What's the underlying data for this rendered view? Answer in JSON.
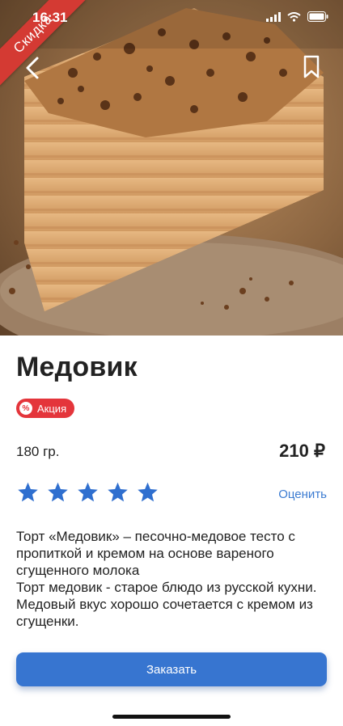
{
  "status_bar": {
    "time": "16:31"
  },
  "hero": {
    "ribbon_label": "Скидка"
  },
  "product": {
    "title": "Медовик",
    "badge": {
      "icon": "%",
      "label": "Акция"
    },
    "weight": "180 гр.",
    "price": "210 ₽",
    "rating": {
      "stars": 5,
      "rate_label": "Оценить"
    },
    "description": [
      "Торт «Медовик» – песочно-медовое тесто с пропиткой и кремом на основе вареного сгущенного молока",
      "Торт медовик - старое блюдо из русской кухни. Медовый вкус хорошо сочетается с кремом из сгущенки."
    ]
  },
  "actions": {
    "order_label": "Заказать"
  },
  "colors": {
    "accent_blue": "#3775d0",
    "link_blue": "#3b7bd1",
    "sale_red": "#e4353b",
    "star_blue": "#2f6fcf"
  }
}
